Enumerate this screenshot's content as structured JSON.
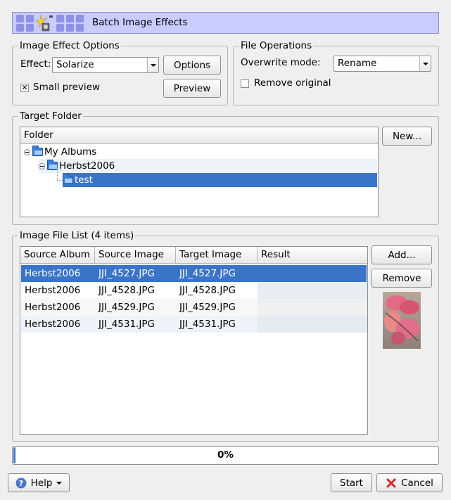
{
  "banner": {
    "title": "Batch Image Effects"
  },
  "effect_options": {
    "group_title": "Image Effect Options",
    "effect_label": "Effect:",
    "effect_value": "Solarize",
    "options_button": "Options",
    "small_preview_label": "Small preview",
    "small_preview_checked": "✕",
    "preview_button": "Preview"
  },
  "file_ops": {
    "group_title": "File Operations",
    "overwrite_label": "Overwrite mode:",
    "overwrite_value": "Rename",
    "remove_original_label": "Remove original"
  },
  "target_folder": {
    "group_title": "Target Folder",
    "column_header": "Folder",
    "new_button": "New...",
    "tree": [
      {
        "label": "My Albums",
        "level": 0,
        "expanded": true
      },
      {
        "label": "Herbst2006",
        "level": 1,
        "expanded": true
      },
      {
        "label": "test",
        "level": 2,
        "selected": true
      }
    ]
  },
  "image_list": {
    "group_title": "Image File List (4 items)",
    "columns": [
      "Source Album",
      "Source Image",
      "Target Image",
      "Result"
    ],
    "rows": [
      {
        "album": "Herbst2006",
        "source": "JJI_4527.JPG",
        "target": "JJI_4527.JPG",
        "result": ""
      },
      {
        "album": "Herbst2006",
        "source": "JJI_4528.JPG",
        "target": "JJI_4528.JPG",
        "result": ""
      },
      {
        "album": "Herbst2006",
        "source": "JJI_4529.JPG",
        "target": "JJI_4529.JPG",
        "result": ""
      },
      {
        "album": "Herbst2006",
        "source": "JJI_4531.JPG",
        "target": "JJI_4531.JPG",
        "result": ""
      }
    ],
    "add_button": "Add...",
    "remove_button": "Remove"
  },
  "progress": {
    "value": 0,
    "label": "0%"
  },
  "footer": {
    "help_button": "Help",
    "start_button": "Start",
    "cancel_button": "Cancel"
  },
  "colors": {
    "accent": "#3a74c8",
    "banner": "#c9ccff",
    "cancel_icon": "#d8262b",
    "help_icon": "#4a78c8"
  },
  "icons": {
    "banner": "effects-icon",
    "help": "help-icon",
    "cancel": "cancel-icon",
    "folder": "folder-open-icon"
  }
}
